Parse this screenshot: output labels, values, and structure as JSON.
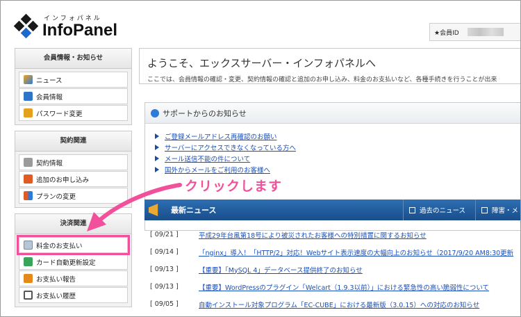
{
  "header": {
    "logo_kana": "インフォパネル",
    "logo_name": "InfoPanel",
    "member_label": "★会員ID"
  },
  "sidebar": {
    "sections": [
      {
        "title": "会員情報・お知らせ",
        "items": [
          {
            "label": "ニュース",
            "icon": "news-icon"
          },
          {
            "label": "会員情報",
            "icon": "member-icon"
          },
          {
            "label": "パスワード変更",
            "icon": "lock-icon"
          }
        ]
      },
      {
        "title": "契約関連",
        "items": [
          {
            "label": "契約情報",
            "icon": "contract-icon"
          },
          {
            "label": "追加のお申し込み",
            "icon": "add-icon"
          },
          {
            "label": "プランの変更",
            "icon": "plan-change-icon"
          }
        ]
      },
      {
        "title": "決済関連",
        "items": [
          {
            "label": "料金のお支払い",
            "icon": "payment-icon"
          },
          {
            "label": "カード自動更新設定",
            "icon": "card-icon"
          },
          {
            "label": "お支払い報告",
            "icon": "report-icon"
          },
          {
            "label": "お支払い履歴",
            "icon": "history-icon"
          }
        ]
      }
    ]
  },
  "welcome": {
    "title": "ようこそ、エックスサーバー・インフォパネルへ",
    "desc": "ここでは、会員情報の確認・変更、契約情報の確認と追加のお申し込み、料金のお支払いなど、各種手続きを行うことが出来"
  },
  "support": {
    "title": "サポートからのお知らせ",
    "links": [
      "ご登録メールアドレス再確認のお願い",
      "サーバーにアクセスできなくなっている方へ",
      "メール送信不能の件について",
      "国外からメールをご利用のお客様へ"
    ]
  },
  "news": {
    "title": "最新ニュース",
    "tabs": [
      "過去のニュース",
      "障害・メ"
    ],
    "rows": [
      {
        "date": "[ 09/21 ]",
        "text": "平成29年台風第18号により被災されたお客様への特別措置に関するお知らせ"
      },
      {
        "date": "[ 09/14 ]",
        "text": "「nginx」導入！「HTTP/2」対応！Webサイト表示速度の大幅向上のお知らせ（2017/9/20 AM8:30更新"
      },
      {
        "date": "[ 09/13 ]",
        "text": "【重要】「MySQL 4」データベース提供終了のお知らせ"
      },
      {
        "date": "[ 09/13 ]",
        "text": "【重要】WordPressのプラグイン「Welcart（1.9.3以前）」における緊急性の高い脆弱性について"
      },
      {
        "date": "[ 09/05 ]",
        "text": "自動インストール対象プログラム「EC-CUBE」における最新版（3.0.15）への対応のお知らせ"
      }
    ]
  },
  "annotation": {
    "text": "クリックします",
    "color": "#f2509a"
  }
}
